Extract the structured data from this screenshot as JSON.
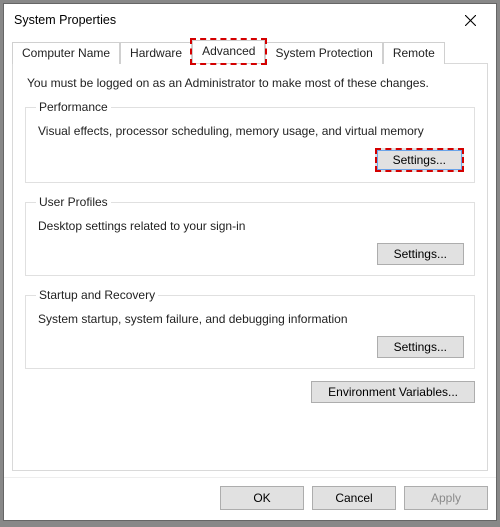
{
  "window": {
    "title": "System Properties"
  },
  "tabs": {
    "items": [
      {
        "label": "Computer Name"
      },
      {
        "label": "Hardware"
      },
      {
        "label": "Advanced"
      },
      {
        "label": "System Protection"
      },
      {
        "label": "Remote"
      }
    ],
    "active_index": 2
  },
  "intro": "You must be logged on as an Administrator to make most of these changes.",
  "groups": {
    "performance": {
      "legend": "Performance",
      "desc": "Visual effects, processor scheduling, memory usage, and virtual memory",
      "button": "Settings..."
    },
    "user_profiles": {
      "legend": "User Profiles",
      "desc": "Desktop settings related to your sign-in",
      "button": "Settings..."
    },
    "startup": {
      "legend": "Startup and Recovery",
      "desc": "System startup, system failure, and debugging information",
      "button": "Settings..."
    }
  },
  "env_button": "Environment Variables...",
  "footer": {
    "ok": "OK",
    "cancel": "Cancel",
    "apply": "Apply"
  }
}
